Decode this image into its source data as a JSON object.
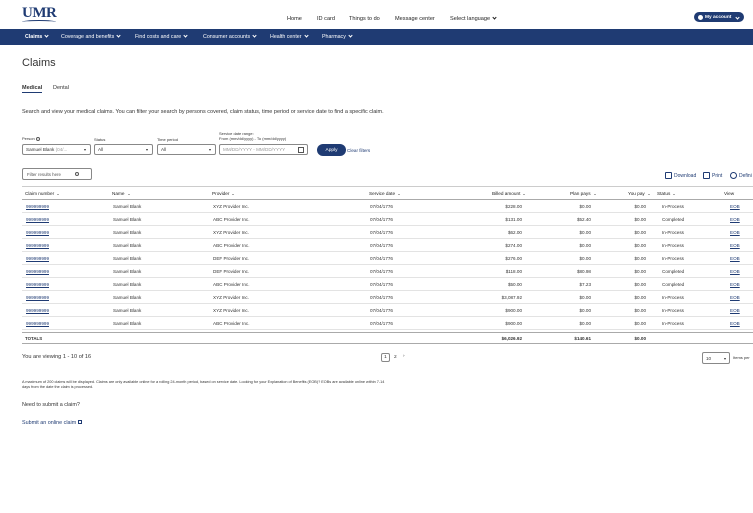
{
  "logo": {
    "text": "UMR"
  },
  "top_nav": [
    "Home",
    "ID card",
    "Things to do",
    "Message center",
    "Select language"
  ],
  "account_button": "My account",
  "main_nav": [
    "Claims",
    "Coverage and benefits",
    "Find costs and care",
    "Consumer accounts",
    "Health center",
    "Pharmacy"
  ],
  "page": {
    "title": "Claims",
    "tabs": [
      "Medical",
      "Dental"
    ],
    "intro": "Search and view your medical claims. You can filter your search by persons covered, claim status, time period or service date to find a specific claim."
  },
  "filters": {
    "person_label": "Person",
    "person_value": "Samuel Blank",
    "person_sub": "(04/...",
    "status_label": "Status",
    "status_value": "All",
    "time_label": "Time period",
    "time_value": "All",
    "date_label": "Service date range:",
    "date_hint": "From (mm/dd/yyyy) - To (mm/dd/yyyy)",
    "date_placeholder": "MM/DD/YYYY - MM/DD/YYYY",
    "apply": "Apply",
    "clear": "Clear filters"
  },
  "results": {
    "search_placeholder": "Filter results here",
    "download": "Download",
    "print": "Print",
    "define": "Defini"
  },
  "table": {
    "headers": [
      "Claim number",
      "Name",
      "Provider",
      "Service date",
      "Billed amount",
      "Plan pays",
      "You pay",
      "Status",
      "View"
    ],
    "rows": [
      [
        "999999999",
        "Samuel Blank",
        "XYZ Provider Inc.",
        "07/04/1776",
        "$228.00",
        "$0.00",
        "$0.00",
        "In-Process",
        "EOB"
      ],
      [
        "999999999",
        "Samuel Blank",
        "ABC Provider Inc.",
        "07/04/1776",
        "$131.00",
        "$52.40",
        "$0.00",
        "Completed",
        "EOB"
      ],
      [
        "999999999",
        "Samuel Blank",
        "XYZ Provider Inc.",
        "07/04/1776",
        "$62.00",
        "$0.00",
        "$0.00",
        "In-Process",
        "EOB"
      ],
      [
        "999999999",
        "Samuel Blank",
        "ABC Provider Inc.",
        "07/04/1776",
        "$274.00",
        "$0.00",
        "$0.00",
        "In-Process",
        "EOB"
      ],
      [
        "999999999",
        "Samuel Blank",
        "DEF Provider Inc.",
        "07/04/1776",
        "$276.00",
        "$0.00",
        "$0.00",
        "In-Process",
        "EOB"
      ],
      [
        "999999999",
        "Samuel Blank",
        "DEF Provider Inc.",
        "07/04/1776",
        "$118.00",
        "$80.98",
        "$0.00",
        "Completed",
        "EOB"
      ],
      [
        "999999999",
        "Samuel Blank",
        "ABC Provider Inc.",
        "07/04/1776",
        "$50.00",
        "$7.23",
        "$0.00",
        "Completed",
        "EOB"
      ],
      [
        "999999999",
        "Samuel Blank",
        "XYZ Provider Inc.",
        "07/04/1776",
        "$3,087.92",
        "$0.00",
        "$0.00",
        "In-Process",
        "EOB"
      ],
      [
        "999999999",
        "Samuel Blank",
        "XYZ Provider Inc.",
        "07/04/1776",
        "$900.00",
        "$0.00",
        "$0.00",
        "In-Process",
        "EOB"
      ],
      [
        "999999999",
        "Samuel Blank",
        "ABC Provider Inc.",
        "07/04/1776",
        "$900.00",
        "$0.00",
        "$0.00",
        "In-Process",
        "EOB"
      ]
    ],
    "totals_label": "TOTALS",
    "totals": {
      "billed": "$6,026.92",
      "plan": "$140.61",
      "you": "$0.00"
    }
  },
  "pagination": {
    "viewing": "You are viewing 1 - 10 of 16",
    "pages": [
      "1",
      "2",
      "›"
    ],
    "per_page": "10",
    "per_page_label": "Items per"
  },
  "footer": {
    "disclaimer": "A maximum of 200 claims will be displayed. Claims are only available online for a rolling 24-month period, based on service date. Looking for your Explanation of Benefits (EOB)? EOBs are available online within 7-14 days from the date the claim is processed.",
    "need_help": "Need to submit a claim?",
    "submit_link": "Submit an online claim"
  },
  "colors": {
    "brand": "#1f3b73"
  }
}
